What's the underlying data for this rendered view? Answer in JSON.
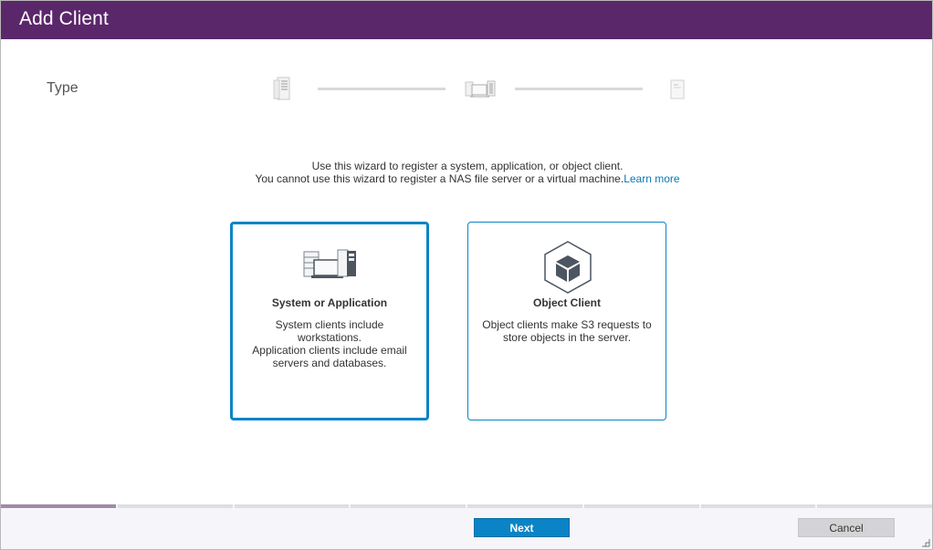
{
  "dialog": {
    "title": "Add Client"
  },
  "wizard": {
    "step_label": "Type",
    "steps": [
      {
        "icon": "server-icon"
      },
      {
        "icon": "system-application-icon"
      },
      {
        "icon": "document-icon"
      }
    ],
    "intro_line1": "Use this wizard to register a system, application, or object client.",
    "intro_line2": "You cannot use this wizard to register a NAS file server or a virtual machine.",
    "learn_more": "Learn more",
    "progress": {
      "completed_segments": 1,
      "total_segments": 8
    }
  },
  "cards": [
    {
      "title": "System or Application",
      "desc_lines": [
        "System clients include workstations.",
        "Application clients include email",
        "servers and databases."
      ],
      "icon": "system-application-icon",
      "selected": true
    },
    {
      "title": "Object Client",
      "desc_lines": [
        "Object clients make S3 requests to",
        "store objects in the server."
      ],
      "icon": "object-cube-icon",
      "selected": false
    }
  ],
  "footer": {
    "next_label": "Next",
    "cancel_label": "Cancel"
  },
  "colors": {
    "titlebar": "#5b276b",
    "accent": "#0a84c6",
    "link": "#0a78b8"
  }
}
